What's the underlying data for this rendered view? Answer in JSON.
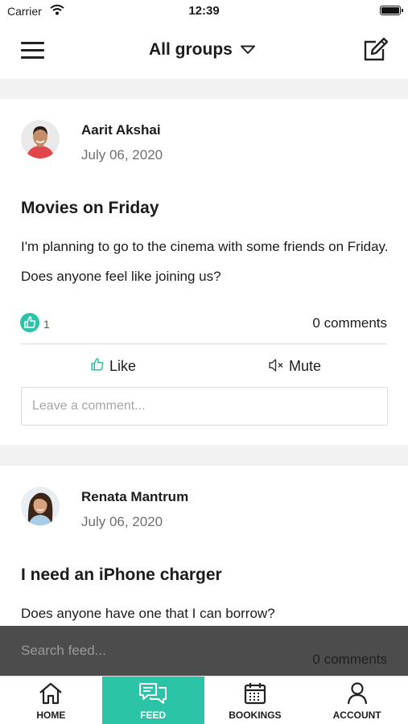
{
  "status": {
    "carrier": "Carrier",
    "time": "12:39"
  },
  "nav": {
    "title": "All groups"
  },
  "posts": [
    {
      "author": "Aarit Akshai",
      "date": "July 06, 2020",
      "title": "Movies on Friday",
      "body": "I'm planning to go to the cinema with some friends on Friday. Does anyone feel like joining us?",
      "likes": "1",
      "comments": "0 comments",
      "like_label": "Like",
      "mute_label": "Mute",
      "comment_placeholder": "Leave a comment..."
    },
    {
      "author": "Renata Mantrum",
      "date": "July 06, 2020",
      "title": "I need an iPhone charger",
      "body": "Does anyone have one that I can borrow?",
      "comments": "0 comments"
    }
  ],
  "search": {
    "placeholder": "Search feed..."
  },
  "tabs": [
    {
      "label": "HOME",
      "icon": "home-icon"
    },
    {
      "label": "FEED",
      "icon": "chat-bubbles-icon",
      "active": true
    },
    {
      "label": "BOOKINGS",
      "icon": "calendar-icon"
    },
    {
      "label": "ACCOUNT",
      "icon": "user-icon"
    }
  ],
  "colors": {
    "accent": "#2bc4a6",
    "search_bar": "#4c4c4c",
    "separator": "#f2f2f2"
  }
}
